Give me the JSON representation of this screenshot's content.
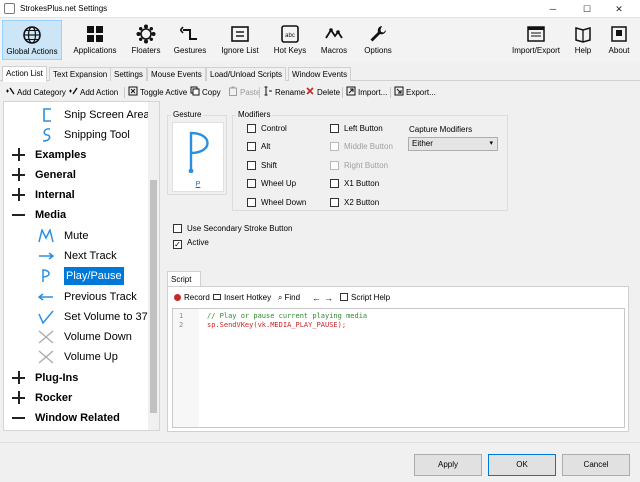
{
  "window": {
    "title": "StrokesPlus.net Settings",
    "minimize": "─",
    "maximize": "☐",
    "close": "✕"
  },
  "toolbar": {
    "items": [
      {
        "label": "Global Actions",
        "icon": "globe-icon"
      },
      {
        "label": "Applications",
        "icon": "applications-icon"
      },
      {
        "label": "Floaters",
        "icon": "floaters-icon"
      },
      {
        "label": "Gestures",
        "icon": "gestures-icon"
      },
      {
        "label": "Ignore List",
        "icon": "ignore-list-icon"
      },
      {
        "label": "Hot Keys",
        "icon": "hot-keys-icon"
      },
      {
        "label": "Macros",
        "icon": "macros-icon"
      },
      {
        "label": "Options",
        "icon": "wrench-icon"
      },
      {
        "label": "Import/Export",
        "icon": "import-export-icon"
      },
      {
        "label": "Help",
        "icon": "help-icon"
      },
      {
        "label": "About",
        "icon": "about-icon"
      }
    ]
  },
  "tabs": [
    "Action List",
    "Text Expansion",
    "Settings",
    "Mouse Events",
    "Load/Unload Scripts",
    "Window Events"
  ],
  "actions": {
    "add_category": "Add Category",
    "add_action": "Add Action",
    "toggle_active": "Toggle Active",
    "copy": "Copy",
    "paste": "Paste",
    "rename": "Rename",
    "delete": "Delete",
    "import": "Import...",
    "export": "Export..."
  },
  "tree": {
    "items": [
      {
        "label": "Snip Screen Area"
      },
      {
        "label": "Snipping Tool"
      },
      {
        "label": "Examples"
      },
      {
        "label": "General"
      },
      {
        "label": "Internal"
      },
      {
        "label": "Media"
      },
      {
        "label": "Mute"
      },
      {
        "label": "Next Track"
      },
      {
        "label": "Play/Pause"
      },
      {
        "label": "Previous Track"
      },
      {
        "label": "Set Volume to 37"
      },
      {
        "label": "Volume Down"
      },
      {
        "label": "Volume Up"
      },
      {
        "label": "Plug-Ins"
      },
      {
        "label": "Rocker"
      },
      {
        "label": "Window Related"
      }
    ]
  },
  "gesture": {
    "group_label": "Gesture",
    "name": "P"
  },
  "modifiers": {
    "group_label": "Modifiers",
    "control": "Control",
    "alt": "Alt",
    "shift": "Shift",
    "wheel_up": "Wheel Up",
    "wheel_down": "Wheel Down",
    "left_button": "Left Button",
    "middle_button": "Middle Button",
    "right_button": "Right Button",
    "x1_button": "X1 Button",
    "x2_button": "X2 Button",
    "capture_label": "Capture Modifiers",
    "capture_value": "Either"
  },
  "options": {
    "secondary": "Use Secondary Stroke Button",
    "active": "Active",
    "active_checked": true
  },
  "script": {
    "tab": "Script",
    "record": "Record",
    "insert_hotkey": "Insert Hotkey",
    "find": "Find",
    "back": "←",
    "forward": "→",
    "help": "Script Help",
    "lines": [
      {
        "num": "1",
        "text": "// Play or pause current playing media"
      },
      {
        "num": "2",
        "text": "sp.SendVKey(vk.MEDIA_PLAY_PAUSE);"
      }
    ]
  },
  "footer": {
    "apply": "Apply",
    "ok": "OK",
    "cancel": "Cancel"
  },
  "colors": {
    "accent": "#0078d7",
    "gesture_blue": "#2b8fe0",
    "comment": "#2e8b2e",
    "code": "#c62828"
  }
}
